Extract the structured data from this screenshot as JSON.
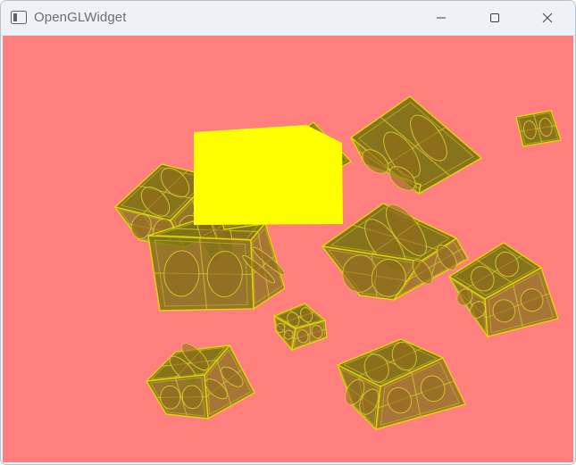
{
  "window": {
    "title": "OpenGLWidget",
    "icons": {
      "app": "window-app-icon",
      "minimize": "minimize-icon",
      "maximize": "maximize-icon",
      "close": "close-icon"
    }
  },
  "viewport": {
    "background_color": "#ff7f7f",
    "crate_color": "#7a7212",
    "crate_edge_color": "#e0d800",
    "selected_object_color": "#ffff00",
    "crate_count": 12,
    "selected_object_count": 1
  }
}
